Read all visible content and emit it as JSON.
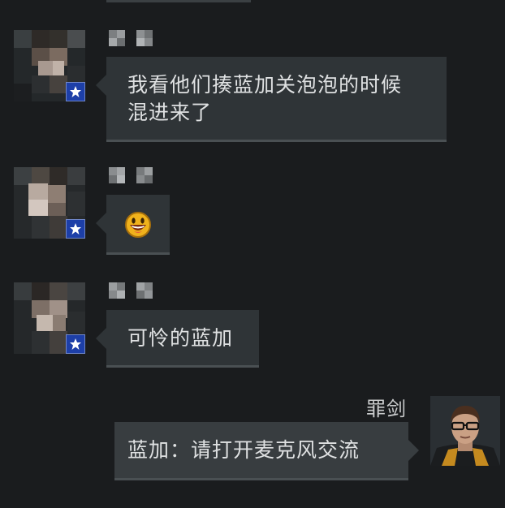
{
  "messages": [
    {
      "side": "left",
      "text": "我看他们揍蓝加关泡泡的时候混进来了",
      "line1": "我看他们揍蓝加关泡泡的时候",
      "line2": "混进来了"
    },
    {
      "side": "left",
      "emoji": "grinning-face-emoji"
    },
    {
      "side": "left",
      "text": "可怜的蓝加"
    },
    {
      "side": "right",
      "sender": "罪剑",
      "text": "蓝加：请打开麦克风交流"
    }
  ],
  "colors": {
    "background": "#1a1c1e",
    "bubble": "#2f3437",
    "bubble_self": "#383d40",
    "badge": "#1d3fa8"
  }
}
